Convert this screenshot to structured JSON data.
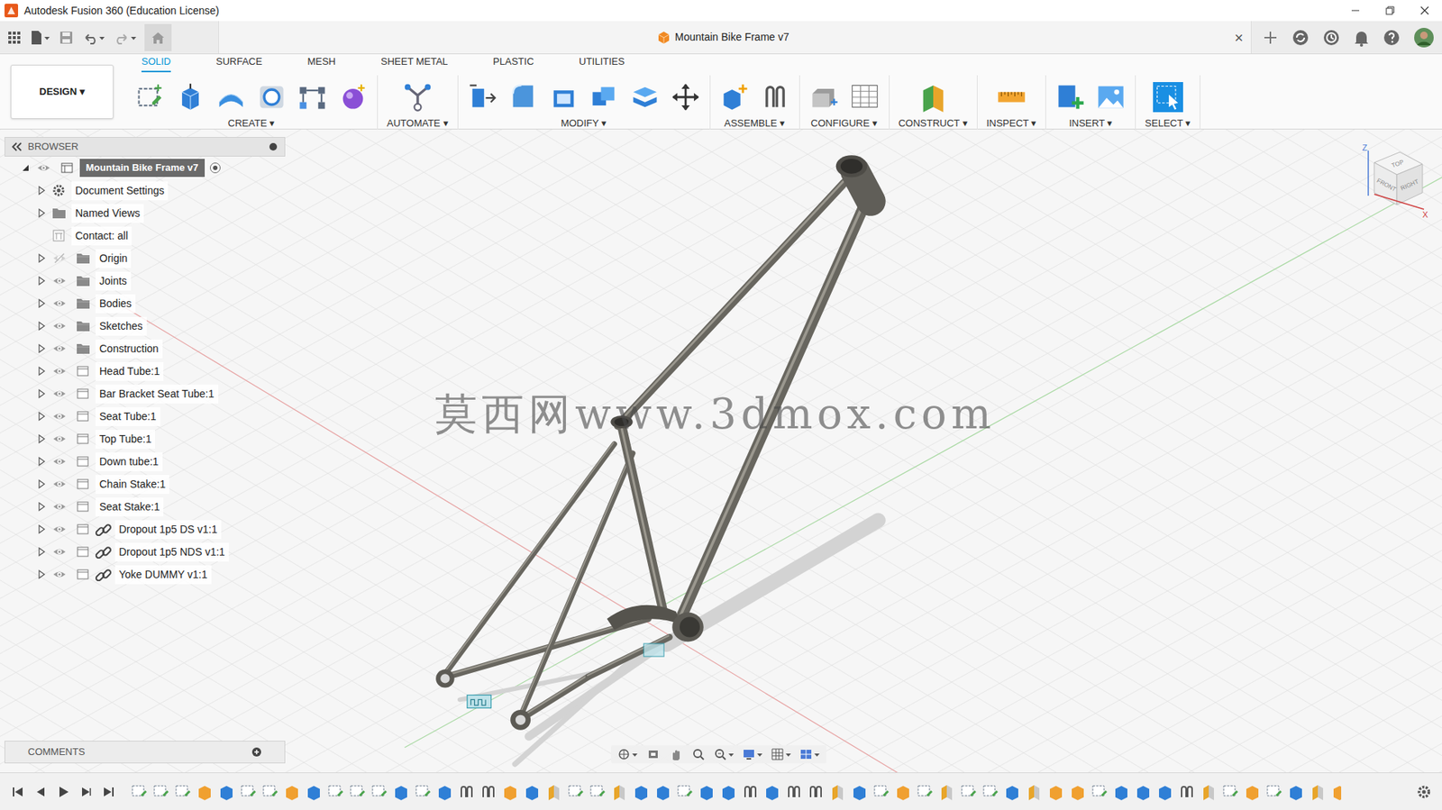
{
  "window": {
    "title": "Autodesk Fusion 360 (Education License)"
  },
  "document_tab": {
    "title": "Mountain Bike Frame v7",
    "close": "×"
  },
  "workspace": {
    "label": "DESIGN ▾"
  },
  "toolbar_tabs": [
    {
      "label": "SOLID",
      "selected": true
    },
    {
      "label": "SURFACE",
      "selected": false
    },
    {
      "label": "MESH",
      "selected": false
    },
    {
      "label": "SHEET METAL",
      "selected": false
    },
    {
      "label": "PLASTIC",
      "selected": false
    },
    {
      "label": "UTILITIES",
      "selected": false
    }
  ],
  "toolbar_groups": [
    {
      "label": "CREATE ▾",
      "active": false
    },
    {
      "label": "AUTOMATE ▾",
      "active": false
    },
    {
      "label": "MODIFY ▾",
      "active": false
    },
    {
      "label": "ASSEMBLE ▾",
      "active": false
    },
    {
      "label": "CONFIGURE ▾",
      "active": false
    },
    {
      "label": "CONSTRUCT ▾",
      "active": false
    },
    {
      "label": "INSPECT ▾",
      "active": false
    },
    {
      "label": "INSERT ▾",
      "active": false
    },
    {
      "label": "SELECT ▾",
      "active": true
    }
  ],
  "browser": {
    "title": "BROWSER",
    "root": {
      "label": "Mountain Bike Frame v7",
      "kind": "root",
      "expanded": true,
      "visible": true,
      "selected": true,
      "children": [
        {
          "label": "Document Settings",
          "kind": "settings",
          "expanded": false
        },
        {
          "label": "Named Views",
          "kind": "views",
          "expanded": false
        },
        {
          "label": "Contact: all",
          "kind": "contact"
        },
        {
          "label": "Origin",
          "kind": "folder",
          "expanded": false,
          "visible": false
        },
        {
          "label": "Joints",
          "kind": "folder",
          "expanded": false,
          "visible": true
        },
        {
          "label": "Bodies",
          "kind": "folder",
          "expanded": false,
          "visible": true
        },
        {
          "label": "Sketches",
          "kind": "folder",
          "expanded": false,
          "visible": true
        },
        {
          "label": "Construction",
          "kind": "folder",
          "expanded": false,
          "visible": true
        },
        {
          "label": "Head Tube:1",
          "kind": "component",
          "expanded": false,
          "visible": true,
          "linked": false
        },
        {
          "label": "Bar Bracket Seat Tube:1",
          "kind": "component",
          "expanded": false,
          "visible": true,
          "linked": false
        },
        {
          "label": "Seat Tube:1",
          "kind": "component",
          "expanded": false,
          "visible": true,
          "linked": false
        },
        {
          "label": "Top Tube:1",
          "kind": "component",
          "expanded": false,
          "visible": true,
          "linked": false
        },
        {
          "label": "Down tube:1",
          "kind": "component",
          "expanded": false,
          "visible": true,
          "linked": false
        },
        {
          "label": "Chain Stake:1",
          "kind": "component",
          "expanded": false,
          "visible": true,
          "linked": false
        },
        {
          "label": "Seat Stake:1",
          "kind": "component",
          "expanded": false,
          "visible": true,
          "linked": false
        },
        {
          "label": "Dropout 1p5 DS v1:1",
          "kind": "component",
          "expanded": false,
          "visible": true,
          "linked": true
        },
        {
          "label": "Dropout 1p5 NDS v1:1",
          "kind": "component",
          "expanded": false,
          "visible": true,
          "linked": true
        },
        {
          "label": "Yoke DUMMY v1:1",
          "kind": "component",
          "expanded": false,
          "visible": true,
          "linked": true
        }
      ]
    }
  },
  "comments": {
    "title": "COMMENTS"
  },
  "viewcube": {
    "top": "TOP",
    "front": "FRONT",
    "right": "RIGHT",
    "z_axis": "Z",
    "x_axis": "X"
  },
  "watermark": "莫西网www.3dmox.com"
}
